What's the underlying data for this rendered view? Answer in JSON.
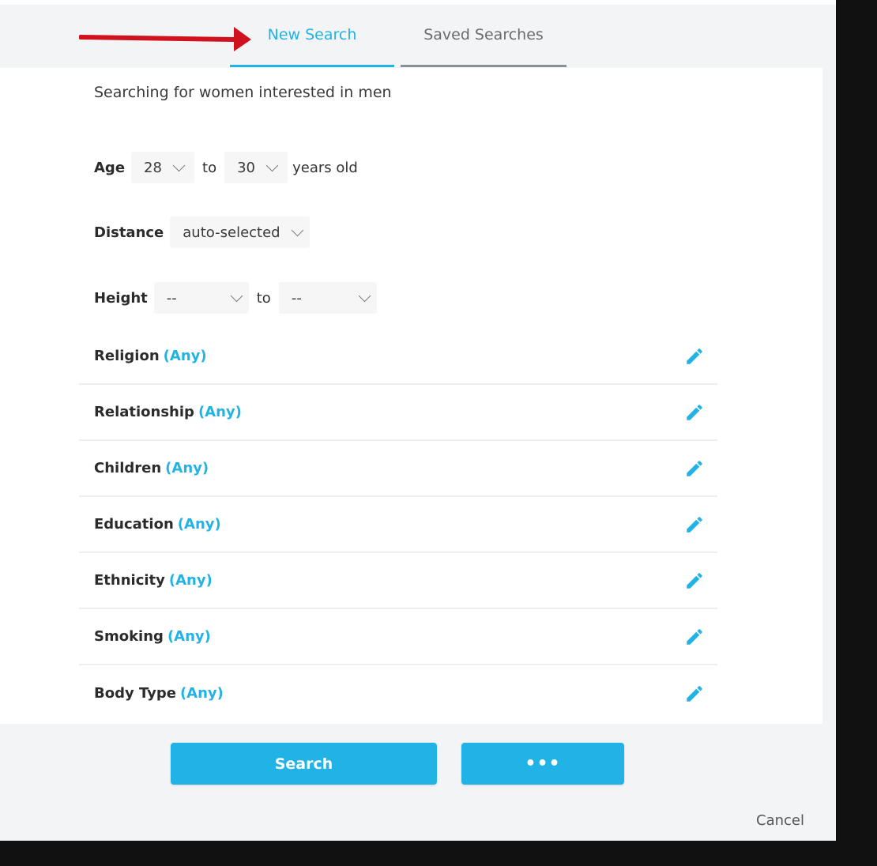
{
  "tabs": {
    "new_search": "New Search",
    "saved_searches": "Saved Searches"
  },
  "intro": "Searching for women interested in men",
  "age": {
    "label": "Age",
    "min": "28",
    "to": "to",
    "max": "30",
    "suffix": "years old"
  },
  "distance": {
    "label": "Distance",
    "value": "auto-selected"
  },
  "height": {
    "label": "Height",
    "min": "--",
    "to": "to",
    "max": "--"
  },
  "criteria": [
    {
      "name": "Religion",
      "value": "(Any)"
    },
    {
      "name": "Relationship",
      "value": "(Any)"
    },
    {
      "name": "Children",
      "value": "(Any)"
    },
    {
      "name": "Education",
      "value": "(Any)"
    },
    {
      "name": "Ethnicity",
      "value": "(Any)"
    },
    {
      "name": "Smoking",
      "value": "(Any)"
    },
    {
      "name": "Body Type",
      "value": "(Any)"
    }
  ],
  "buttons": {
    "search": "Search",
    "more": "•••",
    "cancel": "Cancel"
  },
  "colors": {
    "accent": "#22b3e6",
    "annotation_arrow": "#d0121e"
  },
  "icons": {
    "edit": "pencil-icon",
    "dropdown": "chevron-down-icon",
    "annotation": "red-arrow-icon"
  }
}
